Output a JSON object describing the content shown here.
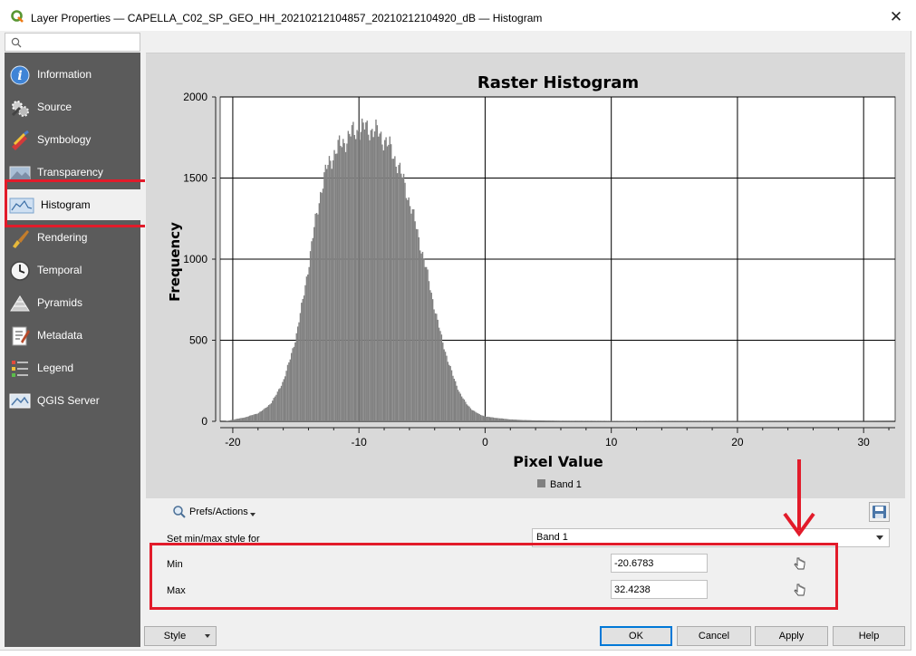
{
  "window": {
    "title": "Layer Properties — CAPELLA_C02_SP_GEO_HH_20210212104857_20210212104920_dB — Histogram",
    "close_glyph": "✕"
  },
  "search": {
    "placeholder": "",
    "icon": "search-icon"
  },
  "sidebar": {
    "items": [
      {
        "label": "Information",
        "icon": "information-icon"
      },
      {
        "label": "Source",
        "icon": "source-icon"
      },
      {
        "label": "Symbology",
        "icon": "symbology-icon"
      },
      {
        "label": "Transparency",
        "icon": "transparency-icon"
      },
      {
        "label": "Histogram",
        "icon": "histogram-icon",
        "active": true
      },
      {
        "label": "Rendering",
        "icon": "rendering-icon"
      },
      {
        "label": "Temporal",
        "icon": "temporal-icon"
      },
      {
        "label": "Pyramids",
        "icon": "pyramids-icon"
      },
      {
        "label": "Metadata",
        "icon": "metadata-icon"
      },
      {
        "label": "Legend",
        "icon": "legend-icon"
      },
      {
        "label": "QGIS Server",
        "icon": "qgis-server-icon"
      }
    ]
  },
  "chart_data": {
    "type": "bar",
    "title": "Raster Histogram",
    "xlabel": "Pixel Value",
    "ylabel": "Frequency",
    "xlim": [
      -21,
      32.5
    ],
    "ylim": [
      0,
      2000
    ],
    "xticks": [
      -20,
      -10,
      0,
      10,
      20,
      30
    ],
    "yticks": [
      0,
      500,
      1000,
      1500,
      2000
    ],
    "grid": true,
    "legend_position": "bottom",
    "series": [
      {
        "name": "Band 1",
        "color": "#808080",
        "x": [
          -20.6,
          -20,
          -19,
          -18,
          -17.5,
          -17,
          -16.5,
          -16,
          -15.5,
          -15,
          -14.5,
          -14,
          -13.5,
          -13,
          -12.5,
          -12,
          -11.5,
          -11,
          -10.5,
          -10,
          -9.5,
          -9,
          -8.5,
          -8,
          -7.5,
          -7,
          -6.5,
          -6,
          -5.5,
          -5,
          -4.5,
          -4,
          -3.5,
          -3,
          -2.5,
          -2,
          -1.5,
          -1,
          -0.5,
          0,
          1,
          2,
          3,
          4,
          6,
          10,
          15,
          20,
          25,
          30,
          32.4
        ],
        "values": [
          0,
          10,
          25,
          50,
          75,
          110,
          170,
          250,
          370,
          520,
          720,
          960,
          1210,
          1430,
          1570,
          1650,
          1700,
          1740,
          1780,
          1800,
          1810,
          1800,
          1780,
          1740,
          1680,
          1600,
          1490,
          1360,
          1210,
          1050,
          880,
          700,
          530,
          390,
          270,
          175,
          110,
          70,
          45,
          30,
          20,
          12,
          8,
          6,
          4,
          3,
          2,
          2,
          1,
          1,
          0
        ]
      }
    ]
  },
  "prefs": {
    "label": "Prefs/Actions",
    "icon": "prefs-actions-icon"
  },
  "minmax": {
    "style_label": "Set min/max style for",
    "band_selected": "Band 1",
    "min_label": "Min",
    "min_value": "-20.6783",
    "max_label": "Max",
    "max_value": "32.4238"
  },
  "annotation": {
    "highlight_color": "#e21b2a"
  },
  "buttons": {
    "style": "Style",
    "ok": "OK",
    "cancel": "Cancel",
    "apply": "Apply",
    "help": "Help"
  }
}
